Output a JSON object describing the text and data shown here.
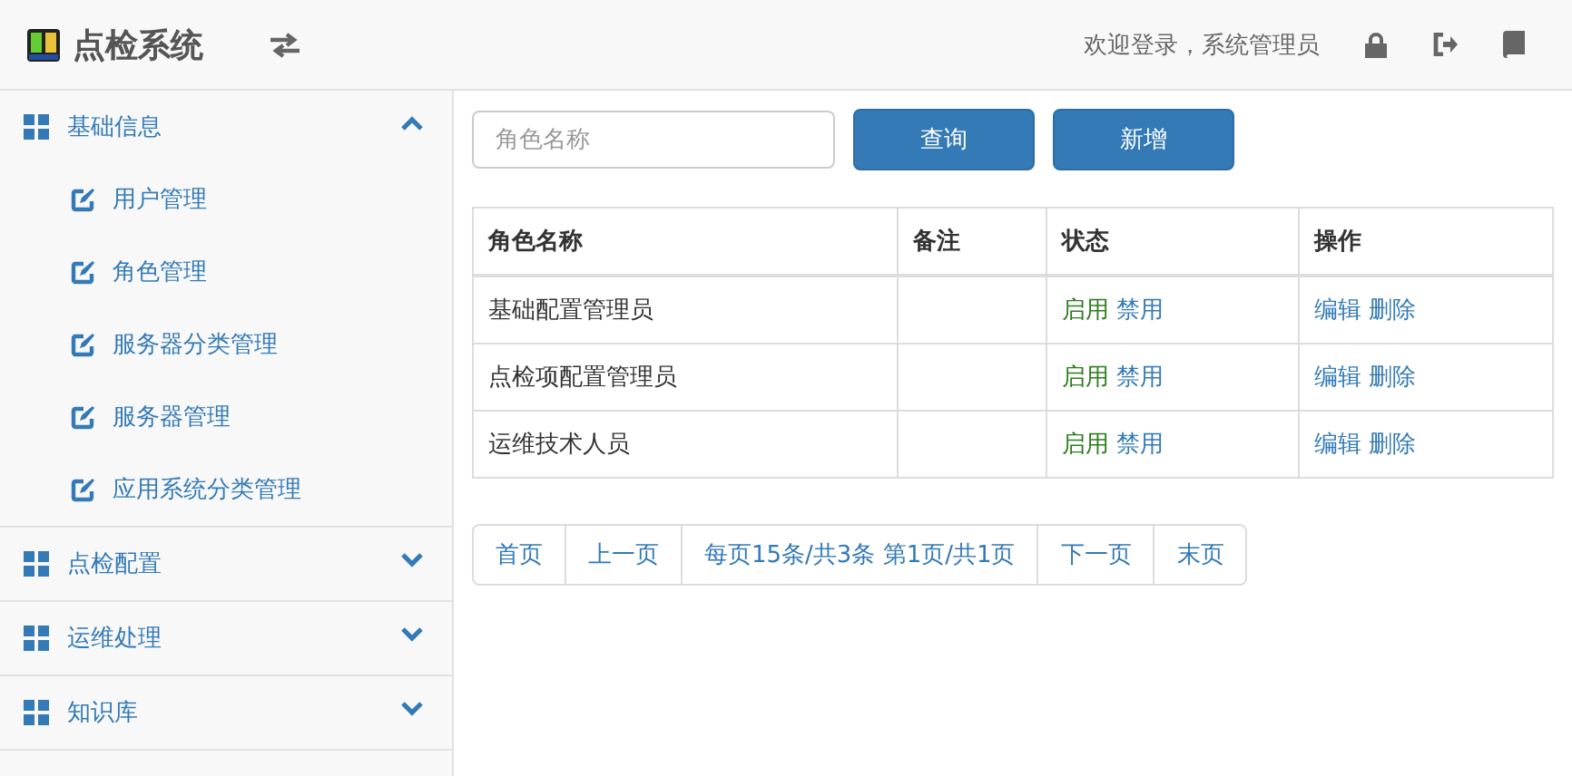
{
  "header": {
    "title": "点检系统",
    "welcome": "欢迎登录，系统管理员"
  },
  "sidebar": {
    "groups": [
      {
        "label": "基础信息",
        "expanded": true,
        "children": [
          {
            "label": "用户管理"
          },
          {
            "label": "角色管理"
          },
          {
            "label": "服务器分类管理"
          },
          {
            "label": "服务器管理"
          },
          {
            "label": "应用系统分类管理"
          }
        ]
      },
      {
        "label": "点检配置",
        "expanded": false
      },
      {
        "label": "运维处理",
        "expanded": false
      },
      {
        "label": "知识库",
        "expanded": false
      }
    ]
  },
  "search": {
    "placeholder": "角色名称"
  },
  "buttons": [
    "查询",
    "新增"
  ],
  "table": {
    "columns": [
      "角色名称",
      "备注",
      "状态",
      "操作"
    ],
    "rows": [
      {
        "name": "基础配置管理员",
        "status": [
          {
            "kind": "enable",
            "label": "启用"
          },
          {
            "kind": "disable",
            "label": "禁用"
          }
        ],
        "actions": [
          "编辑",
          "删除"
        ]
      },
      {
        "name": "点检项配置管理员",
        "status": [
          {
            "kind": "enable",
            "label": "启用"
          },
          {
            "kind": "disable",
            "label": "禁用"
          }
        ],
        "actions": [
          "编辑",
          "删除"
        ]
      },
      {
        "name": "运维技术人员",
        "status": [
          {
            "kind": "enable",
            "label": "启用"
          },
          {
            "kind": "disable",
            "label": "禁用"
          }
        ],
        "actions": [
          "编辑",
          "删除"
        ]
      }
    ]
  },
  "pagination": [
    "首页",
    "上一页",
    "每页15条/共3条 第1页/共1页",
    "下一页",
    "末页"
  ]
}
